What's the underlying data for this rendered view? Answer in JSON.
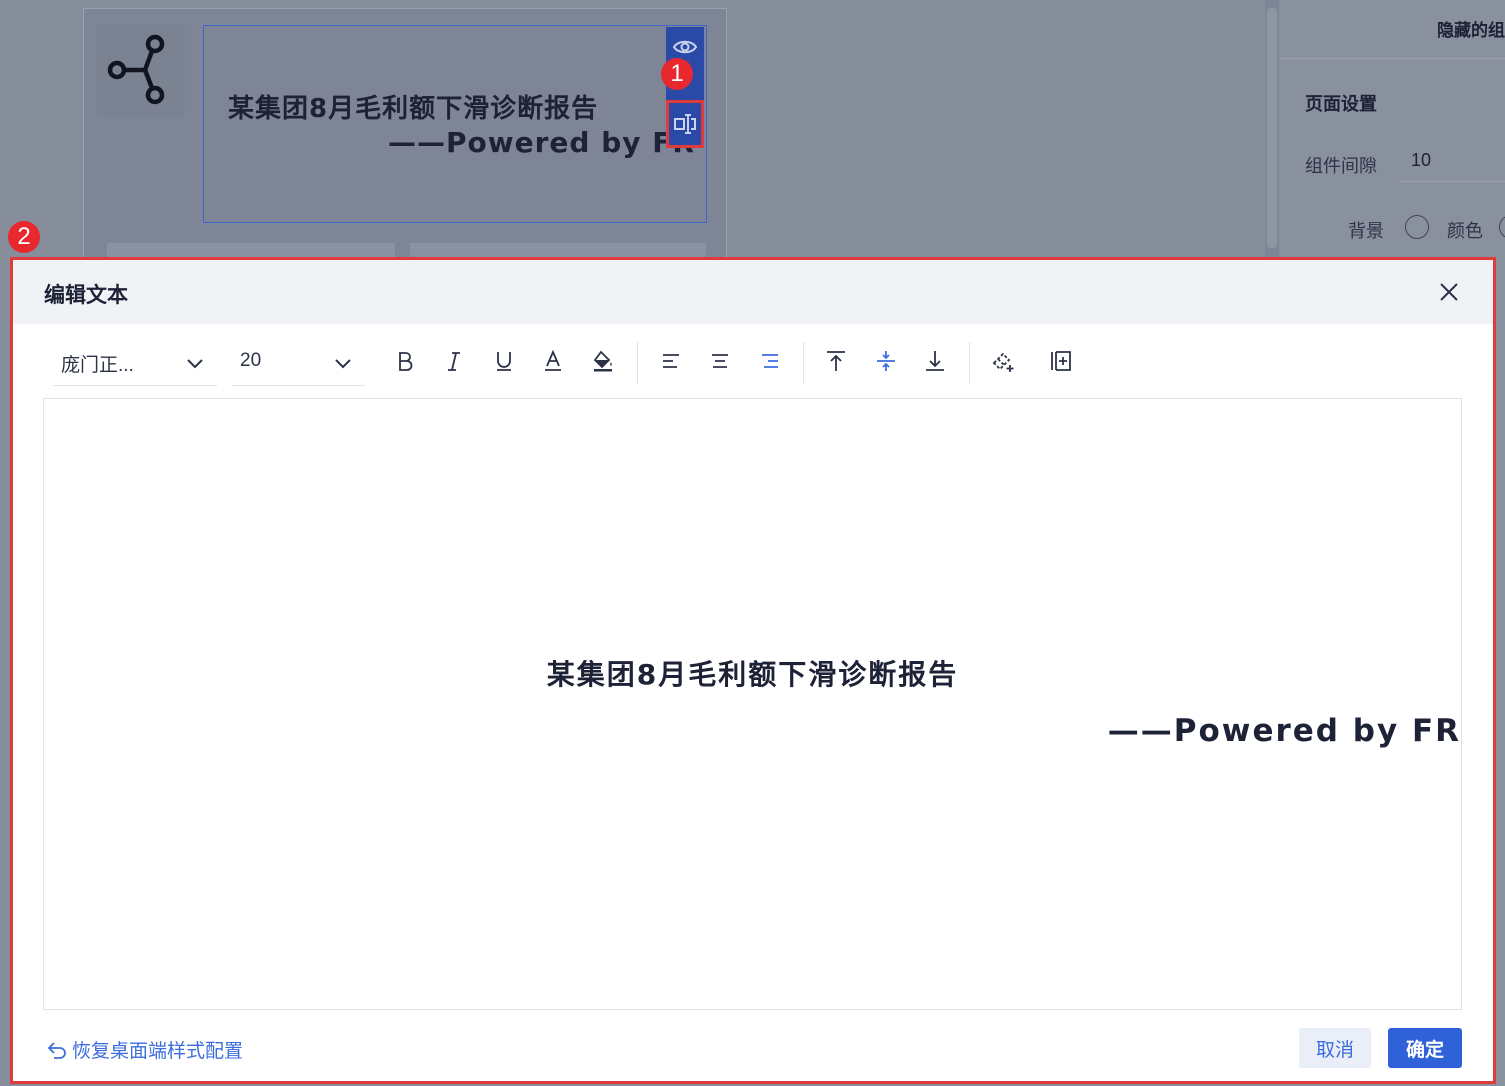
{
  "background": {
    "canvas_title_line1": "某集团8月毛利额下滑诊断报告",
    "canvas_title_line2": "——Powered by FR",
    "side_panel": {
      "header": "隐藏的组",
      "section": "页面设置",
      "gap_label": "组件间隙",
      "gap_value": "10",
      "background_label": "背景",
      "color_option": "颜色"
    }
  },
  "annotations": {
    "badge1": "1",
    "badge2": "2"
  },
  "modal": {
    "title": "编辑文本",
    "toolbar": {
      "font_family": "庞门正...",
      "font_size": "20",
      "icons": [
        "bold-icon",
        "italic-icon",
        "underline-icon",
        "font-color-icon",
        "fill-color-icon",
        "align-left-icon",
        "align-center-icon",
        "align-right-icon",
        "valign-top-icon",
        "valign-middle-icon",
        "valign-bottom-icon",
        "clear-format-icon",
        "insert-column-icon"
      ],
      "active_color": "#3d6ddc"
    },
    "editor": {
      "line1": "某集团8月毛利额下滑诊断报告",
      "line2": "——Powered by FR"
    },
    "footer": {
      "restore_link": "恢复桌面端样式配置",
      "cancel": "取消",
      "confirm": "确定"
    }
  }
}
